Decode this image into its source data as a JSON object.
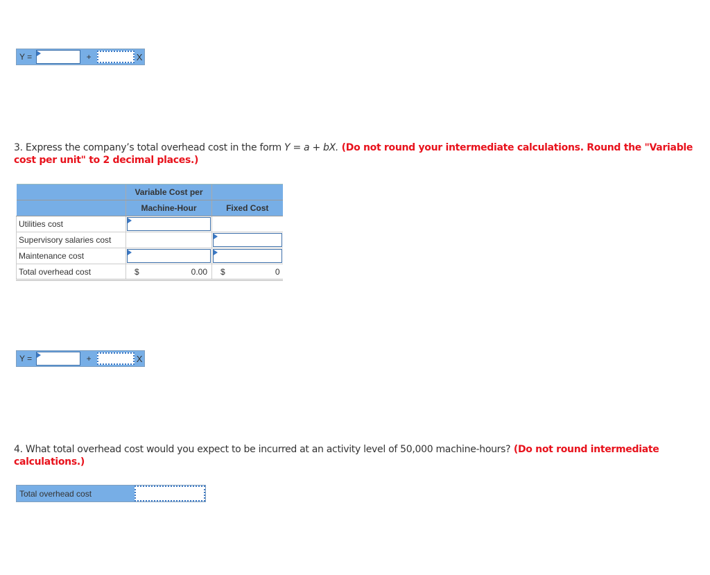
{
  "equation_1": {
    "y_label": "Y =",
    "a_value": "",
    "plus": "+",
    "b_value": "",
    "x_label": "X"
  },
  "question_3": {
    "text_prefix": "3. Express the company’s total overhead cost in the form ",
    "formula": "Y = a + bX.",
    "instruction": " (Do not round your intermediate calculations. Round the \"Variable cost per unit\" to 2 decimal places.)"
  },
  "cost_table": {
    "header_row1": [
      "",
      "Variable Cost per",
      ""
    ],
    "header_row2": [
      "",
      "Machine-Hour",
      "Fixed Cost"
    ],
    "rows": [
      {
        "label": "Utilities cost",
        "variable": "",
        "fixed": ""
      },
      {
        "label": "Supervisory salaries cost",
        "variable": "",
        "fixed": ""
      },
      {
        "label": "Maintenance cost",
        "variable": "",
        "fixed": ""
      }
    ],
    "total": {
      "label": "Total overhead cost",
      "var_currency": "$",
      "variable": "0.00",
      "fixed_currency": "$",
      "fixed": "0"
    }
  },
  "equation_2": {
    "y_label": "Y =",
    "a_value": "",
    "plus": "+",
    "b_value": "",
    "x_label": "X"
  },
  "question_4": {
    "text": "4. What total overhead cost would you expect to be incurred at an activity level of 50,000 machine-hours?",
    "instruction": " (Do not round intermediate calculations.)"
  },
  "answer_4": {
    "label": "Total overhead cost",
    "value": ""
  }
}
